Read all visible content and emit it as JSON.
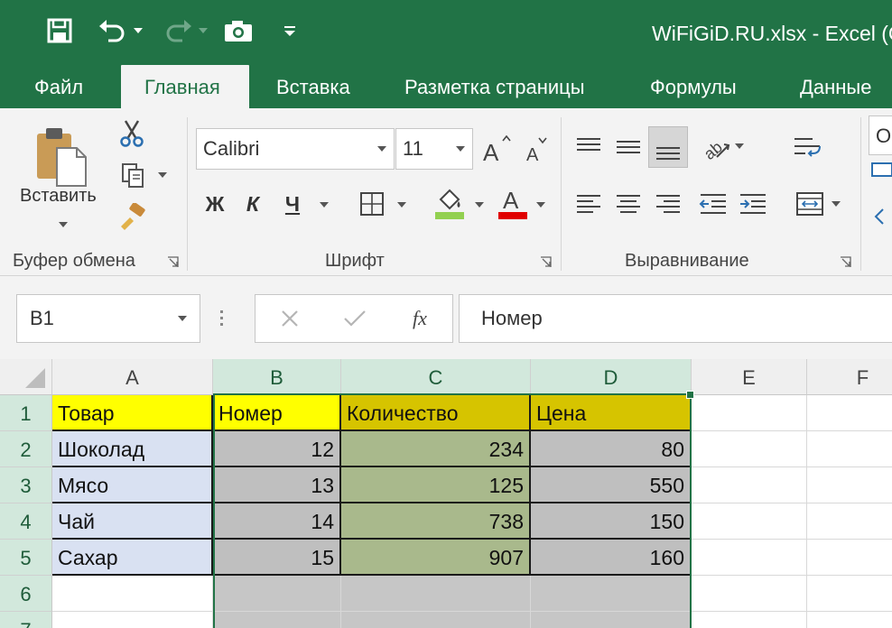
{
  "window": {
    "title": "WiFiGiD.RU.xlsx - Excel (C"
  },
  "quick_access": {
    "icons": [
      "save-icon",
      "undo-icon",
      "redo-icon",
      "camera-icon",
      "customize-icon"
    ]
  },
  "tabs": [
    {
      "label": "Файл",
      "active": false
    },
    {
      "label": "Главная",
      "active": true
    },
    {
      "label": "Вставка",
      "active": false
    },
    {
      "label": "Разметка страницы",
      "active": false
    },
    {
      "label": "Формулы",
      "active": false
    },
    {
      "label": "Данные",
      "active": false
    }
  ],
  "ribbon": {
    "clipboard": {
      "label": "Буфер обмена",
      "paste_label": "Вставить"
    },
    "font": {
      "label": "Шрифт",
      "font_name": "Calibri",
      "font_size": "11",
      "bold": "Ж",
      "italic": "К",
      "underline": "Ч"
    },
    "alignment": {
      "label": "Выравнивание"
    },
    "number": {
      "format_partial": "О"
    }
  },
  "formula_bar": {
    "name_box": "B1",
    "fx_label": "fx",
    "content": "Номер"
  },
  "sheet": {
    "columns": [
      "A",
      "B",
      "C",
      "D",
      "E",
      "F"
    ],
    "selected_columns": [
      "B",
      "C",
      "D"
    ],
    "rows": [
      "1",
      "2",
      "3",
      "4",
      "5",
      "6",
      "7"
    ],
    "cells": [
      [
        "Товар",
        "Номер",
        "Количество",
        "Цена"
      ],
      [
        "Шоколад",
        "12",
        "234",
        "80"
      ],
      [
        "Мясо",
        "13",
        "125",
        "550"
      ],
      [
        "Чай",
        "14",
        "738",
        "150"
      ],
      [
        "Сахар",
        "15",
        "907",
        "160"
      ]
    ]
  },
  "colors": {
    "brand": "#217346",
    "header_fill": "#ffff00",
    "header_fill_selected": "#d6c400",
    "name_column_fill": "#d9e1f2",
    "number_column_fill": "#bfbfbf",
    "quantity_column_fill": "#a9b98c"
  }
}
